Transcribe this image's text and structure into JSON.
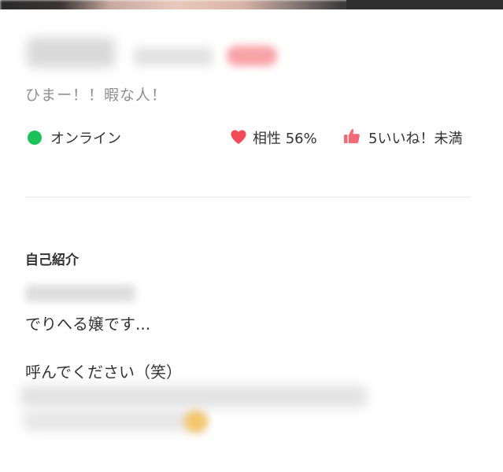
{
  "profile": {
    "tagline": "ひまー！！暇な人！",
    "status": {
      "online_label": "オンライン",
      "online_color": "#1cc15a",
      "compatibility": "相性 56%",
      "likes": "5いいね！未満"
    },
    "bio": {
      "section_title": "自己紹介",
      "lines": [
        "でりへる嬢です...",
        "呼んでください（笑）"
      ]
    }
  },
  "colors": {
    "accent_heart": "#f04b56",
    "accent_thumb": "#f26a73",
    "text_primary": "#333333",
    "text_muted": "#8f8f8f"
  },
  "icons": {
    "status": "online-dot",
    "compatibility": "heart-icon",
    "likes": "thumbs-up-icon"
  }
}
